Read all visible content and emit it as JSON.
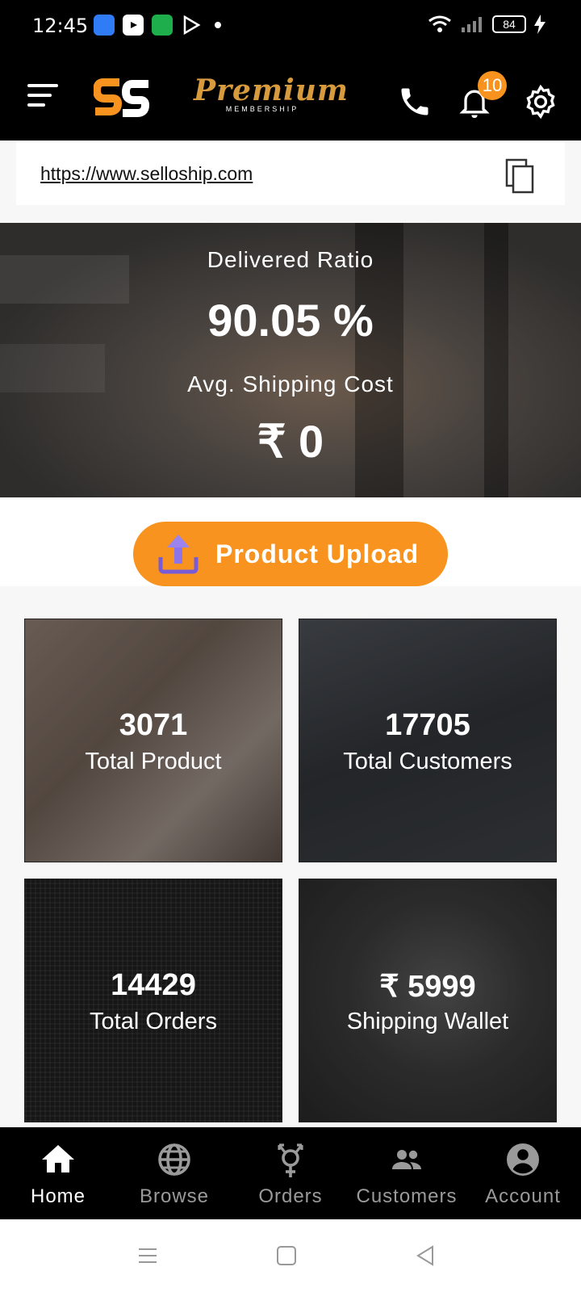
{
  "status_bar": {
    "time": "12:45",
    "battery": "84",
    "apps": [
      "messages-icon",
      "youtube-icon",
      "shield-icon",
      "play-store-icon"
    ]
  },
  "header": {
    "logo_text": "SS",
    "premium_title": "Premium",
    "premium_subtitle": "MEMBERSHIP",
    "notification_count": "10",
    "accent": "#f7931e"
  },
  "url_bar": {
    "url": "https://www.selloship.com"
  },
  "hero": {
    "delivered_label": "Delivered Ratio",
    "delivered_value": "90.05 %",
    "shipping_label": "Avg. Shipping Cost",
    "shipping_value": "₹ 0"
  },
  "upload_button": {
    "label": "Product Upload"
  },
  "stats": [
    {
      "value": "3071",
      "label": "Total Product"
    },
    {
      "value": "17705",
      "label": "Total Customers"
    },
    {
      "value": "14429",
      "label": "Total Orders"
    },
    {
      "value": "₹ 5999",
      "label": "Shipping Wallet"
    }
  ],
  "bottom_nav": [
    {
      "label": "Home",
      "icon": "home-icon",
      "active": true
    },
    {
      "label": "Browse",
      "icon": "globe-icon",
      "active": false
    },
    {
      "label": "Orders",
      "icon": "gender-icon",
      "active": false
    },
    {
      "label": "Customers",
      "icon": "people-icon",
      "active": false
    },
    {
      "label": "Account",
      "icon": "account-icon",
      "active": false
    }
  ]
}
